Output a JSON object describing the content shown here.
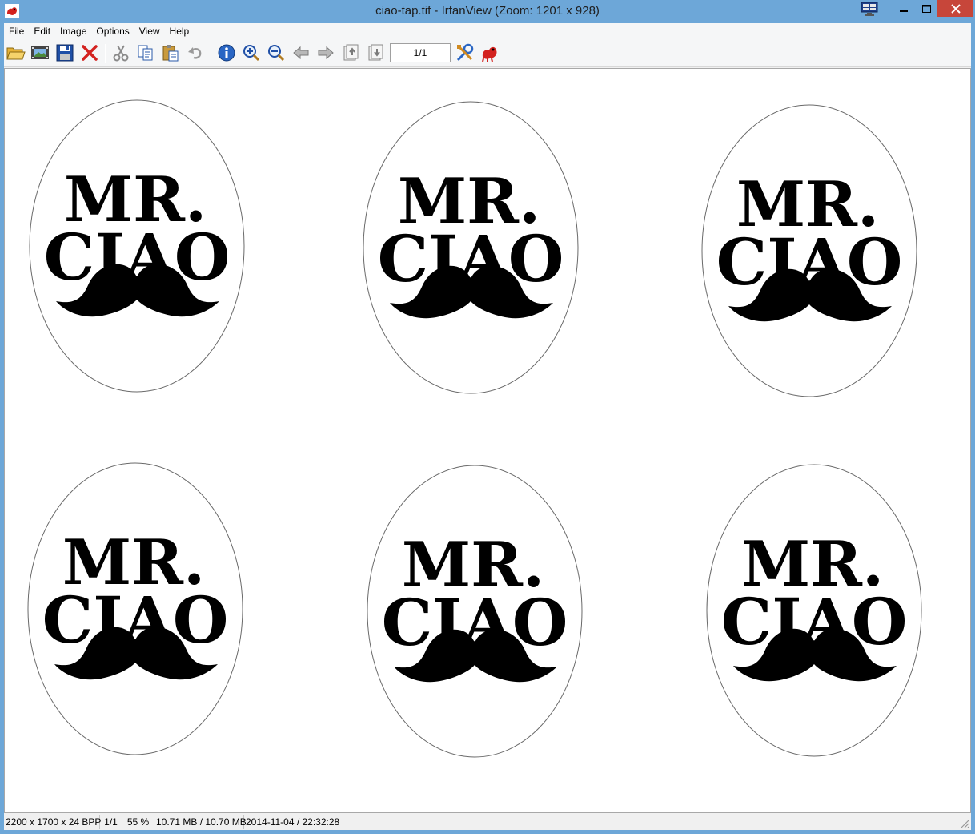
{
  "window": {
    "title": "ciao-tap.tif - IrfanView (Zoom: 1201 x 928)",
    "accent": "#6da7d8",
    "close_color": "#c7463a"
  },
  "menu": [
    "File",
    "Edit",
    "Image",
    "Options",
    "View",
    "Help"
  ],
  "toolbar": {
    "icons": [
      "open-folder-icon",
      "slideshow-icon",
      "save-icon",
      "delete-icon",
      "cut-icon",
      "copy-icon",
      "paste-icon",
      "undo-icon",
      "info-icon",
      "zoom-in-icon",
      "zoom-out-icon",
      "previous-icon",
      "next-icon",
      "first-page-icon",
      "next-page-icon",
      "settings-icon",
      "irfanview-logo-icon"
    ],
    "page": "1/1"
  },
  "image": {
    "sticker_line1": "MR.",
    "sticker_line2": "CIAO",
    "count": 6
  },
  "status": {
    "dimensions": "2200 x 1700 x 24 BPP",
    "page": "1/1",
    "zoom": "55 %",
    "size": "10.71 MB / 10.70 MB",
    "datetime": "2014-11-04 / 22:32:28"
  }
}
